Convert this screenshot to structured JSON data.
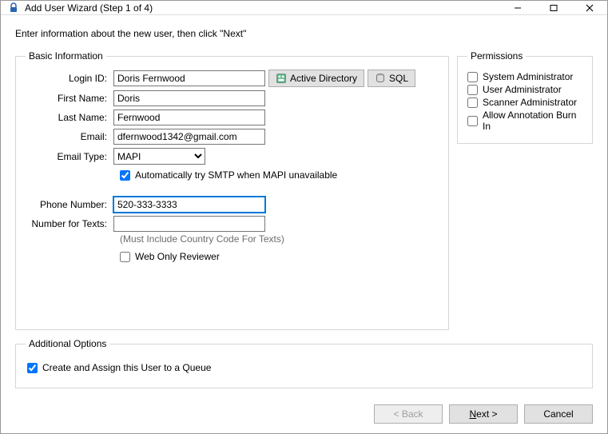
{
  "window": {
    "title": "Add User Wizard (Step 1 of 4)"
  },
  "intro": "Enter information about the new user, then click \"Next\"",
  "basic": {
    "legend": "Basic Information",
    "login_id_label": "Login ID:",
    "login_id": "Doris Fernwood",
    "first_name_label": "First Name:",
    "first_name": "Doris",
    "last_name_label": "Last Name:",
    "last_name": "Fernwood",
    "email_label": "Email:",
    "email": "dfernwood1342@gmail.com",
    "email_type_label": "Email Type:",
    "email_type": "MAPI",
    "smtp_fallback_label": "Automatically try SMTP when MAPI unavailable",
    "phone_label": "Phone Number:",
    "phone": "520-333-3333",
    "texts_label": "Number for Texts:",
    "texts": "",
    "texts_hint": "(Must Include Country Code For Texts)",
    "web_only_label": "Web Only Reviewer",
    "ad_button": "Active Directory",
    "sql_button": "SQL"
  },
  "permissions": {
    "legend": "Permissions",
    "sys_admin": "System Administrator",
    "user_admin": "User Administrator",
    "scanner_admin": "Scanner Administrator",
    "burn_in": "Allow Annotation Burn In"
  },
  "additional": {
    "legend": "Additional Options",
    "queue_label": "Create and Assign this User to a Queue"
  },
  "footer": {
    "back": "< Back",
    "next": "Next >",
    "cancel": "Cancel"
  }
}
